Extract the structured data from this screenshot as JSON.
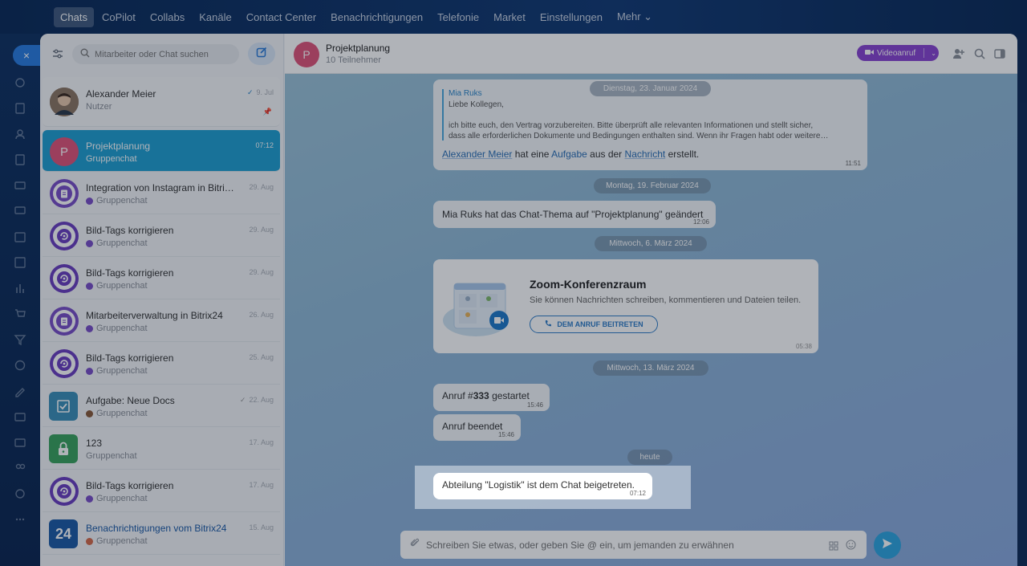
{
  "topnav": {
    "items": [
      "Chats",
      "CoPilot",
      "Collabs",
      "Kanäle",
      "Contact Center",
      "Benachrichtigungen",
      "Telefonie",
      "Market",
      "Einstellungen",
      "Mehr ⌄"
    ],
    "active": "Chats"
  },
  "rail": {
    "close": "×",
    "icons": [
      "sync-icon",
      "newspaper-icon",
      "users-icon",
      "document-icon",
      "card-icon",
      "monitor-icon",
      "calendar-icon",
      "task-check-icon",
      "chart-icon",
      "cart-icon",
      "filter-funnel-icon",
      "clock-icon",
      "pen-icon",
      "box-icon",
      "mail-icon",
      "people-icon",
      "gear-icon",
      "dots-icon"
    ]
  },
  "sidebar": {
    "search_placeholder": "Mitarbeiter oder Chat suchen",
    "chats": [
      {
        "title": "Alexander Meier",
        "subtitle": "Nutzer",
        "date": "9. Jul",
        "avatar": "photo",
        "avatar_color": "#6b5a4a",
        "read": true,
        "pinned": true
      },
      {
        "title": "Projektplanung",
        "subtitle": "Gruppenchat",
        "date": "07:12",
        "avatar": "P",
        "avatar_color": "#e0547a",
        "selected": true
      },
      {
        "title": "Integration von Instagram in Bitrix24",
        "subtitle": "Gruppenchat",
        "date": "29. Aug",
        "avatar": "doc",
        "avatar_color": "#7a4fc8"
      },
      {
        "title": "Bild-Tags korrigieren",
        "subtitle": "Gruppenchat",
        "date": "29. Aug",
        "avatar": "cycle",
        "avatar_color": "#6a3fc0"
      },
      {
        "title": "Bild-Tags korrigieren",
        "subtitle": "Gruppenchat",
        "date": "29. Aug",
        "avatar": "cycle",
        "avatar_color": "#6a3fc0"
      },
      {
        "title": "Mitarbeiterverwaltung in Bitrix24",
        "subtitle": "Gruppenchat",
        "date": "26. Aug",
        "avatar": "doc",
        "avatar_color": "#7a4fc8"
      },
      {
        "title": "Bild-Tags korrigieren",
        "subtitle": "Gruppenchat",
        "date": "25. Aug",
        "avatar": "cycle",
        "avatar_color": "#6a3fc0"
      },
      {
        "title": "Aufgabe: Neue Docs",
        "subtitle": "Gruppenchat",
        "date": "22. Aug",
        "avatar": "task",
        "avatar_color": "#3b8fb8",
        "read": true
      },
      {
        "title": "123",
        "subtitle": "Gruppenchat",
        "date": "17. Aug",
        "avatar": "lock",
        "avatar_color": "#3aa35e"
      },
      {
        "title": "Bild-Tags korrigieren",
        "subtitle": "Gruppenchat",
        "date": "17. Aug",
        "avatar": "cycle",
        "avatar_color": "#6a3fc0"
      },
      {
        "title": "Benachrichtigungen vom Bitrix24",
        "subtitle": "Gruppenchat",
        "date": "15. Aug",
        "avatar": "24",
        "avatar_color": "#1c5aa6"
      }
    ]
  },
  "header": {
    "avatar": "P",
    "title": "Projektplanung",
    "subtitle": "10 Teilnehmer",
    "video_label": "Videoanruf"
  },
  "messages": {
    "date1": "Dienstag, 23. Januar 2024",
    "quote_author": "Mia Ruks",
    "quote_line1": "Liebe Kollegen,",
    "quote_line2": "ich bitte euch, den Vertrag vorzubereiten. Bitte überprüft alle relevanten Informationen und stellt sicher,",
    "quote_line3": "dass alle erforderlichen Dokumente und Bedingungen enthalten sind. Wenn ihr Fragen habt oder weitere…",
    "task_user": "Alexander Meier",
    "task_mid1": "hat eine",
    "task_link": "Aufgabe",
    "task_mid2": "aus der",
    "task_msg": "Nachricht",
    "task_end": "erstellt.",
    "time1": "11:51",
    "date2": "Montag, 19. Februar 2024",
    "topic_change": "Mia Ruks hat das Chat-Thema auf \"Projektplanung\" geändert",
    "time2": "12:06",
    "date3": "Mittwoch, 6. März 2024",
    "zoom_title": "Zoom-Konferenzraum",
    "zoom_desc": "Sie können Nachrichten schreiben, kommentieren und Dateien teilen.",
    "zoom_button": "DEM ANRUF BEITRETEN",
    "time3": "05:38",
    "date4": "Mittwoch, 13. März 2024",
    "call_start_prefix": "Anruf #",
    "call_number": "333",
    "call_start_suffix": "gestartet",
    "time4": "15:46",
    "call_end": "Anruf beendet",
    "time5": "15:46",
    "date5": "heute",
    "joined": "Abteilung \"Logistik\" ist dem Chat beigetreten.",
    "time6": "07:12"
  },
  "composer": {
    "placeholder": "Schreiben Sie etwas, oder geben Sie @ ein, um jemanden zu erwähnen"
  },
  "colors": {
    "accent": "#1f9fd1",
    "video": "#8a44d1",
    "send": "#2fa6e0"
  }
}
